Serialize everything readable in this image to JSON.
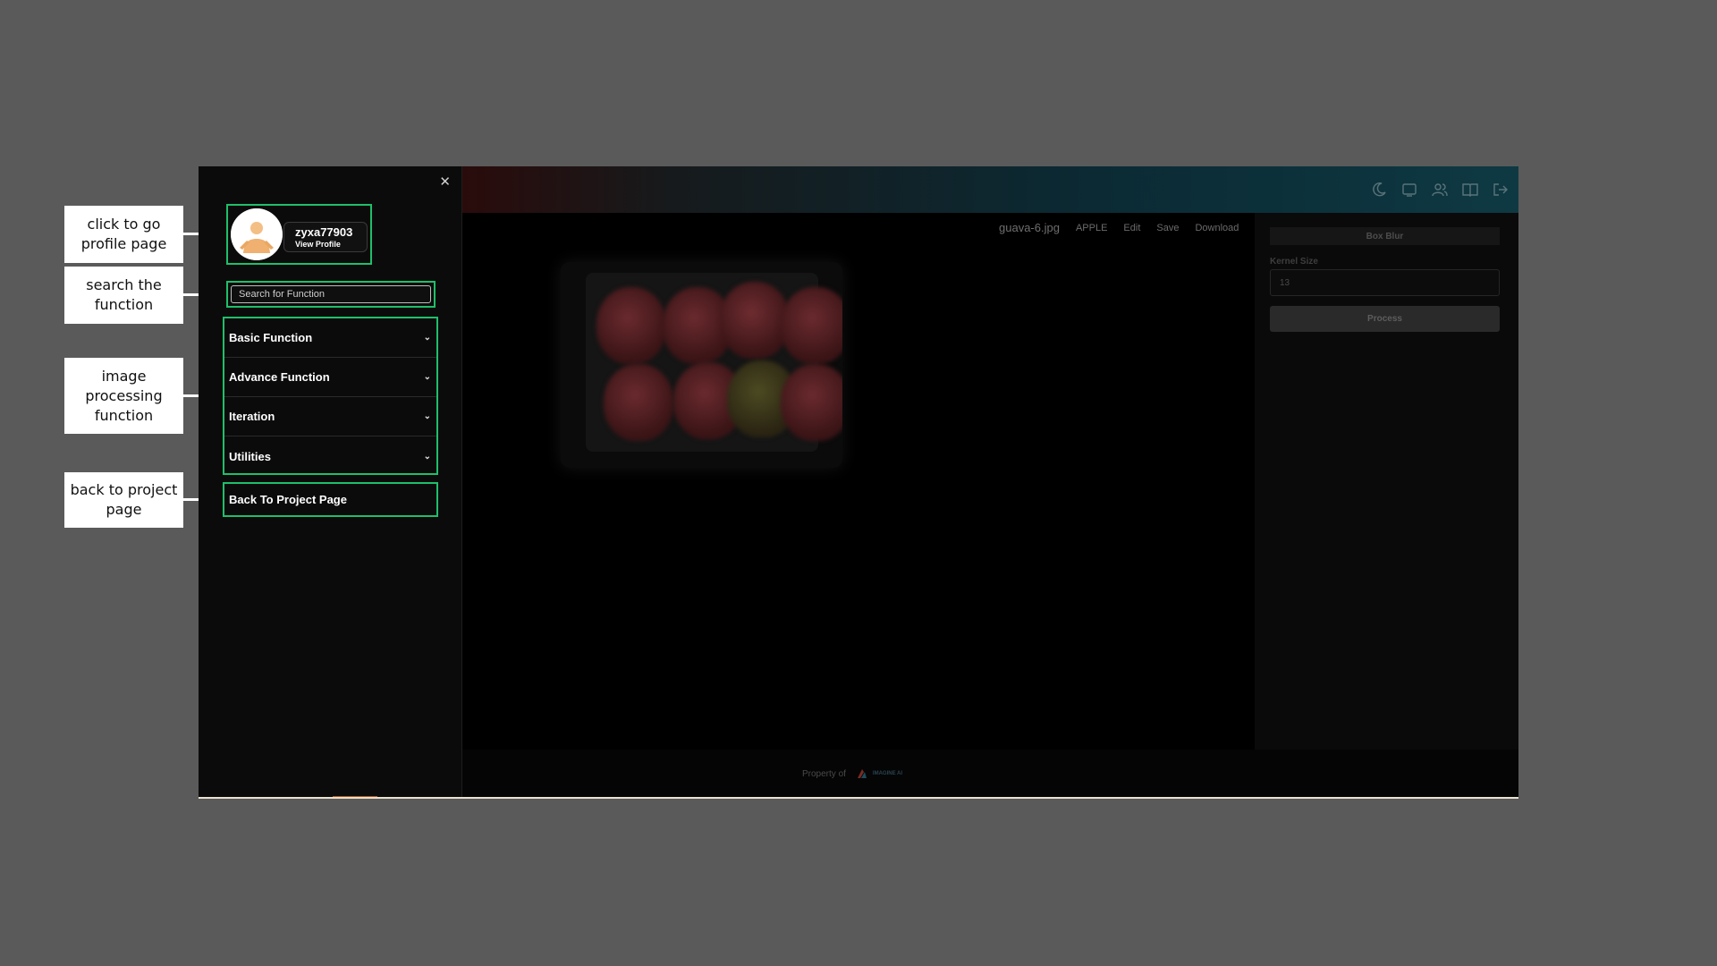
{
  "annotations": [
    {
      "id": "profile",
      "text": "click to go profile page"
    },
    {
      "id": "search",
      "text": "search the function"
    },
    {
      "id": "functions",
      "text": "image processing function"
    },
    {
      "id": "back",
      "text": "back to project page"
    }
  ],
  "sidebar": {
    "close_icon": "close-icon",
    "profile": {
      "username": "zyxa77903",
      "view_label": "View Profile"
    },
    "search": {
      "placeholder": "Search for Function"
    },
    "function_groups": [
      {
        "label": "Basic Function"
      },
      {
        "label": "Advance Function"
      },
      {
        "label": "Iteration"
      },
      {
        "label": "Utilities"
      }
    ],
    "back_label": "Back To Project Page"
  },
  "header": {
    "icons": [
      "moon-icon",
      "monitor-icon",
      "users-icon",
      "book-icon",
      "logout-icon"
    ]
  },
  "toolbar": {
    "filename": "guava-6.jpg",
    "label_tag": "APPLE",
    "edit_label": "Edit",
    "save_label": "Save",
    "download_label": "Download"
  },
  "panel": {
    "title": "Box Blur",
    "kernel_label": "Kernel Size",
    "kernel_value": "13",
    "process_label": "Process"
  },
  "footer": {
    "text": "Property of",
    "brand": "IMAGINE AI"
  },
  "colors": {
    "highlight": "#1fbf6a",
    "background": "#5a5a5a",
    "sidebar": "#0b0b0c"
  }
}
